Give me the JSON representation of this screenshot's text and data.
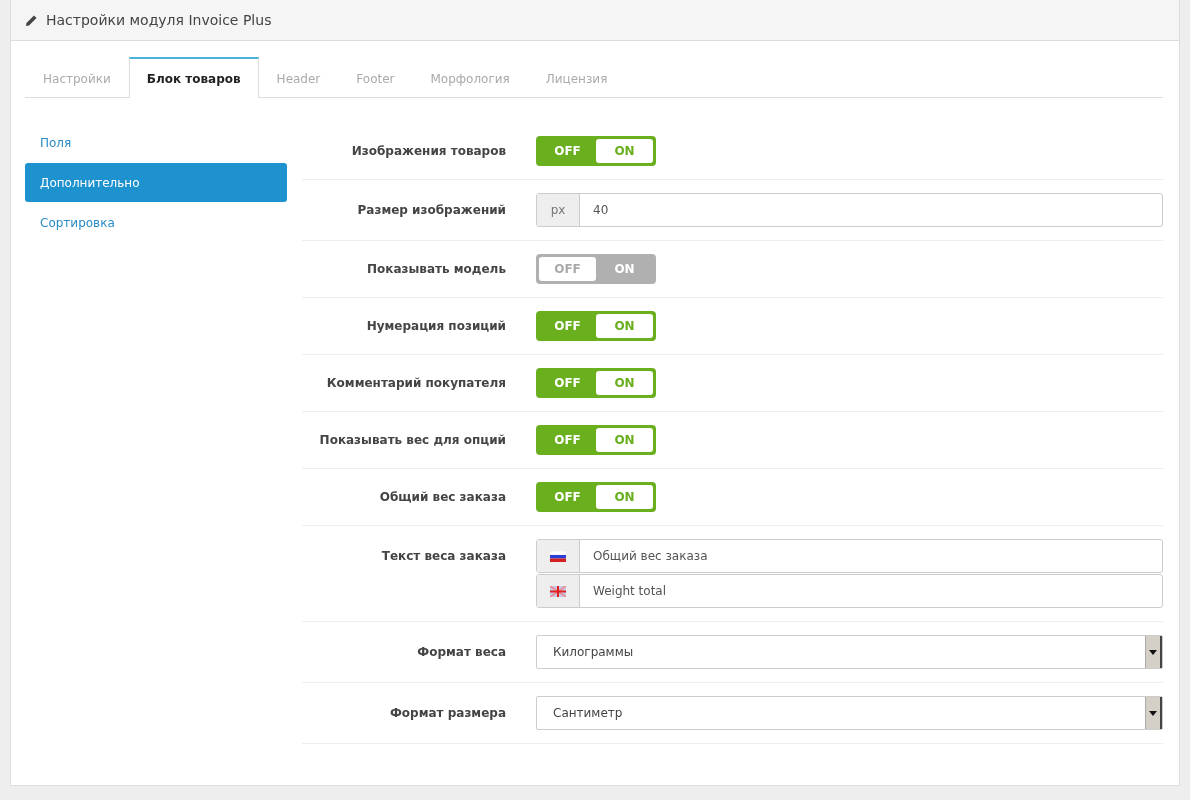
{
  "panel": {
    "title": "Настройки модуля Invoice Plus"
  },
  "tabs": [
    {
      "label": "Настройки",
      "selected": false
    },
    {
      "label": "Блок товаров",
      "selected": true
    },
    {
      "label": "Header",
      "selected": false
    },
    {
      "label": "Footer",
      "selected": false
    },
    {
      "label": "Морфология",
      "selected": false
    },
    {
      "label": "Лицензия",
      "selected": false
    }
  ],
  "sidebar": {
    "items": [
      {
        "label": "Поля",
        "selected": false
      },
      {
        "label": "Дополнительно",
        "selected": true
      },
      {
        "label": "Сортировка",
        "selected": false
      }
    ]
  },
  "fields": [
    {
      "kind": "toggle",
      "label": "Изображения товаров",
      "off_label": "OFF",
      "on_label": "ON",
      "on": true
    },
    {
      "kind": "addon",
      "label": "Размер изображений",
      "addon": "px",
      "value": "40"
    },
    {
      "kind": "toggle",
      "label": "Показывать модель",
      "off_label": "OFF",
      "on_label": "ON",
      "on": false
    },
    {
      "kind": "toggle",
      "label": "Нумерация позиций",
      "off_label": "OFF",
      "on_label": "ON",
      "on": true
    },
    {
      "kind": "toggle",
      "label": "Комментарий покупателя",
      "off_label": "OFF",
      "on_label": "ON",
      "on": true
    },
    {
      "kind": "toggle",
      "label": "Показывать вес для опций",
      "off_label": "OFF",
      "on_label": "ON",
      "on": true
    },
    {
      "kind": "toggle",
      "label": "Общий вес заказа",
      "off_label": "OFF",
      "on_label": "ON",
      "on": true
    },
    {
      "kind": "multilang",
      "label": "Текст веса заказа",
      "values": [
        {
          "kind": "ru",
          "value": "Общий вес заказа"
        },
        {
          "kind": "gb",
          "value": "Weight total"
        }
      ]
    },
    {
      "kind": "select",
      "label": "Формат веса",
      "value": "Килограммы"
    },
    {
      "kind": "select",
      "label": "Формат размера",
      "value": "Сантиметр"
    }
  ]
}
